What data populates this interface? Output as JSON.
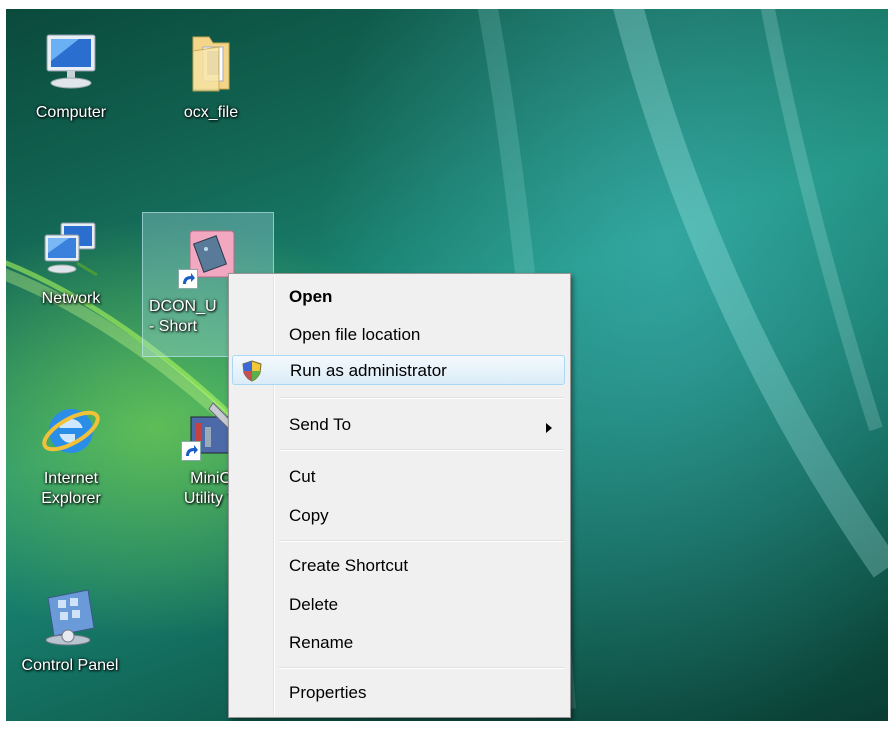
{
  "desktop": {
    "icons": [
      {
        "label": "Computer"
      },
      {
        "label": "ocx_file"
      },
      {
        "label": "Network"
      },
      {
        "label": "DCON_U\n- Short"
      },
      {
        "label": "Internet\nExplorer"
      },
      {
        "label": "MiniO\nUtility V"
      },
      {
        "label": "Control Panel"
      }
    ]
  },
  "context_menu": {
    "items": [
      {
        "label": "Open",
        "bold": true
      },
      {
        "label": "Open file location"
      },
      {
        "label": "Run as administrator",
        "icon": "uac-shield-icon",
        "highlighted": true
      },
      {
        "label": "Send To",
        "submenu": true
      },
      {
        "label": "Cut"
      },
      {
        "label": "Copy"
      },
      {
        "label": "Create Shortcut"
      },
      {
        "label": "Delete"
      },
      {
        "label": "Rename"
      },
      {
        "label": "Properties"
      }
    ]
  }
}
